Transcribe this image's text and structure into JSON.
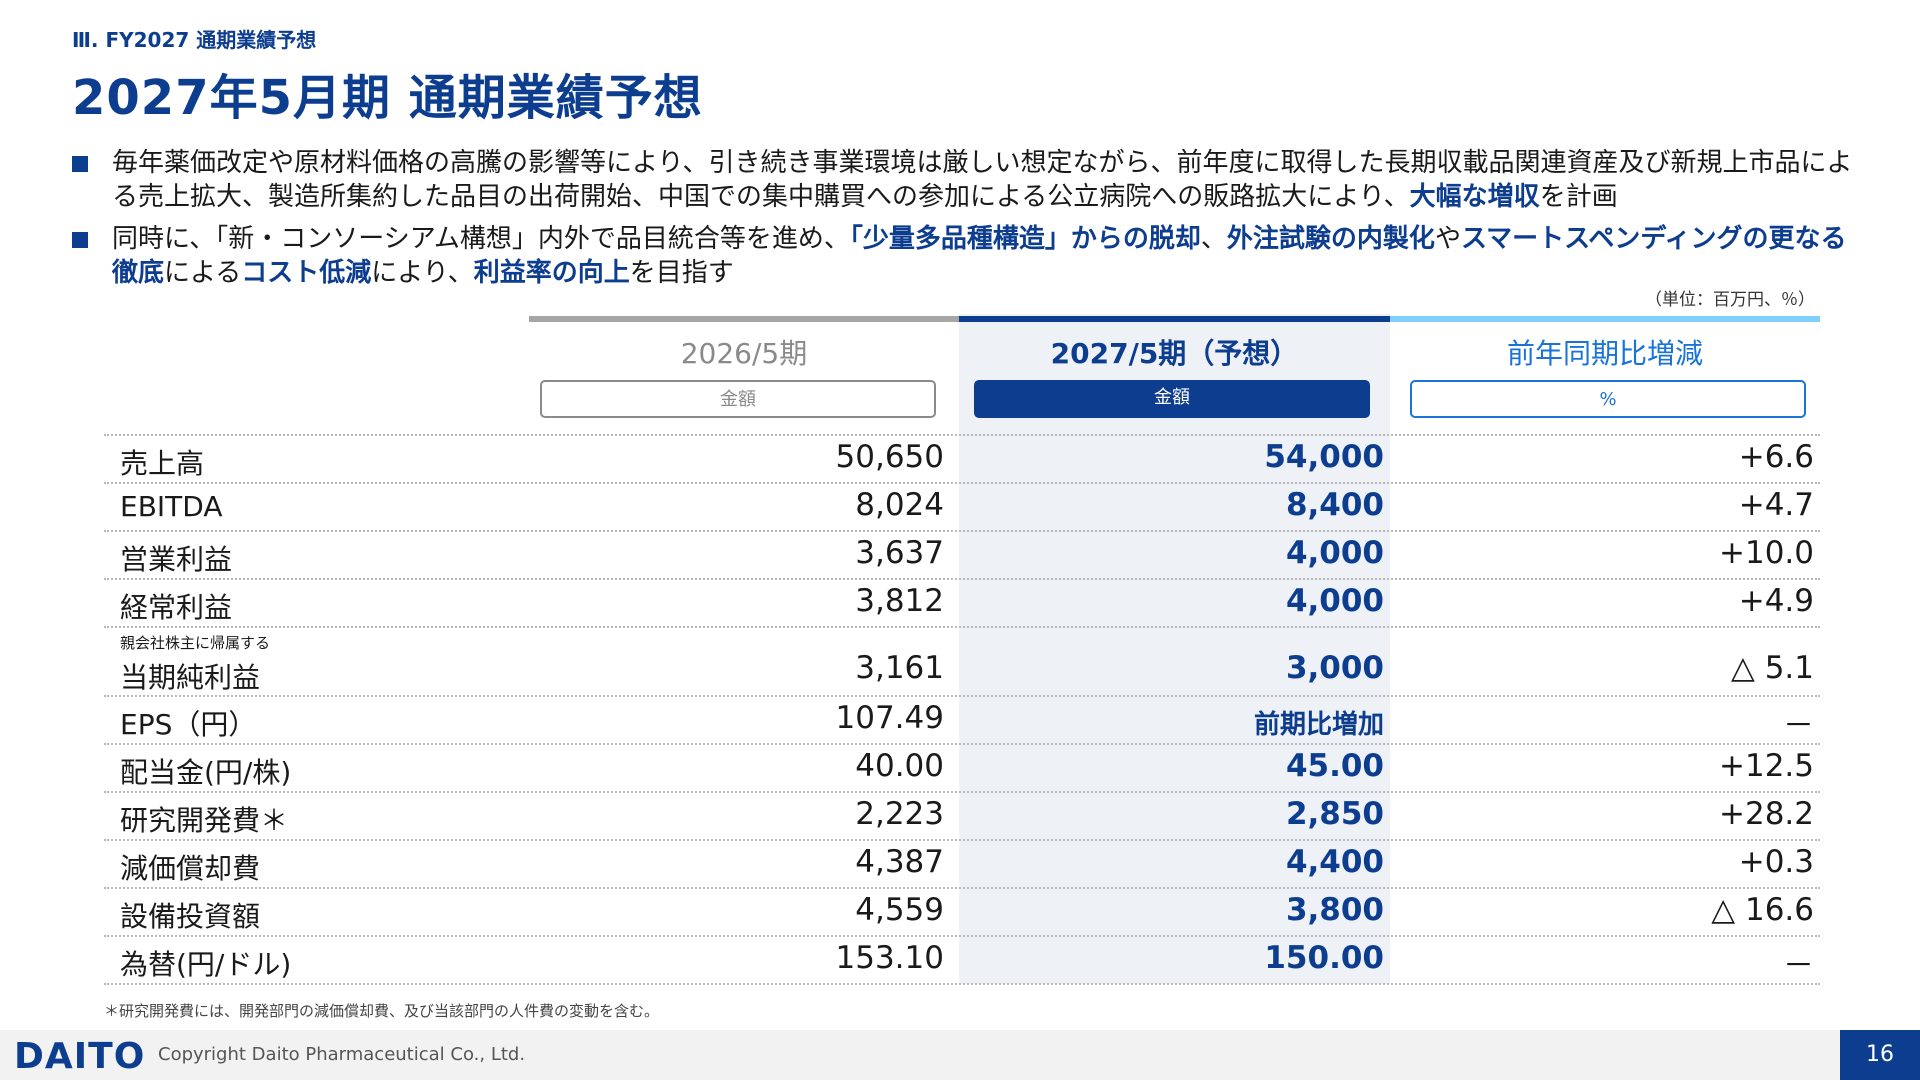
{
  "section": "Ⅲ. FY2027 通期業績予想",
  "title": "2027年5月期 通期業績予想",
  "bullets": [
    [
      "毎年薬価改定や原材料価格の高騰の影響等により、引き続き事業環境は厳しい想定ながら、前年度に取得した長期収載品関連資産及び新規上市品による売上拡大、製造所集約した品目の出荷開始、中国での集中購買への参加による公立病院への販路拡大により、",
      "大幅な増収",
      "を計画"
    ],
    [
      "同時に、「新・コンソーシアム構想」内外で品目統合等を進め、",
      "「少量多品種構造」からの脱却",
      "、",
      "外注試験の内製化",
      "や",
      "スマートスペンディングの更なる徹底",
      "による",
      "コスト低減",
      "により、",
      "利益率の向上",
      "を目指す"
    ]
  ],
  "unit": "（単位：百万円、％）",
  "columns": [
    {
      "title": "2026/5期",
      "pill": "金額",
      "bar_color": "#a6a6a6"
    },
    {
      "title": "2027/5期（予想）",
      "pill": "金額",
      "bar_color": "#0d3d8f"
    },
    {
      "title": "前年同期比増減",
      "pill": "%",
      "bar_color": "#7fcfff"
    }
  ],
  "colors": {
    "brand": "#0d3d8f",
    "accent": "#1a73d9",
    "light": "#7fcfff"
  },
  "rows": [
    {
      "label": "売上高",
      "v1": "50,650",
      "v2": "54,000",
      "v3": "+6.6"
    },
    {
      "label": "EBITDA",
      "v1": "8,024",
      "v2": "8,400",
      "v3": "+4.7"
    },
    {
      "label": "営業利益",
      "v1": "3,637",
      "v2": "4,000",
      "v3": "+10.0"
    },
    {
      "label": "経常利益",
      "v1": "3,812",
      "v2": "4,000",
      "v3": "+4.9"
    },
    {
      "small": "親会社株主に帰属する",
      "label": "当期純利益",
      "v1": "3,161",
      "v2": "3,000",
      "v3": "△ 5.1"
    },
    {
      "label": "EPS（円）",
      "v1": "107.49",
      "v2": "前期比増加",
      "v3": "－"
    },
    {
      "label": "配当金(円/株)",
      "v1": "40.00",
      "v2": "45.00",
      "v3": "+12.5"
    },
    {
      "label": "研究開発費＊",
      "v1": "2,223",
      "v2": "2,850",
      "v3": "+28.2"
    },
    {
      "label": "減価償却費",
      "v1": "4,387",
      "v2": "4,400",
      "v3": "+0.3"
    },
    {
      "label": "設備投資額",
      "v1": "4,559",
      "v2": "3,800",
      "v3": "△ 16.6"
    },
    {
      "label": "為替(円/ドル)",
      "v1": "153.10",
      "v2": "150.00",
      "v3": "－"
    }
  ],
  "footnote": "＊研究開発費には、開発部門の減価償却費、及び当該部門の人件費の変動を含む。",
  "footer": {
    "logo": "DAITO",
    "copyright": "Copyright Daito Pharmaceutical Co., Ltd.",
    "page": "16"
  }
}
